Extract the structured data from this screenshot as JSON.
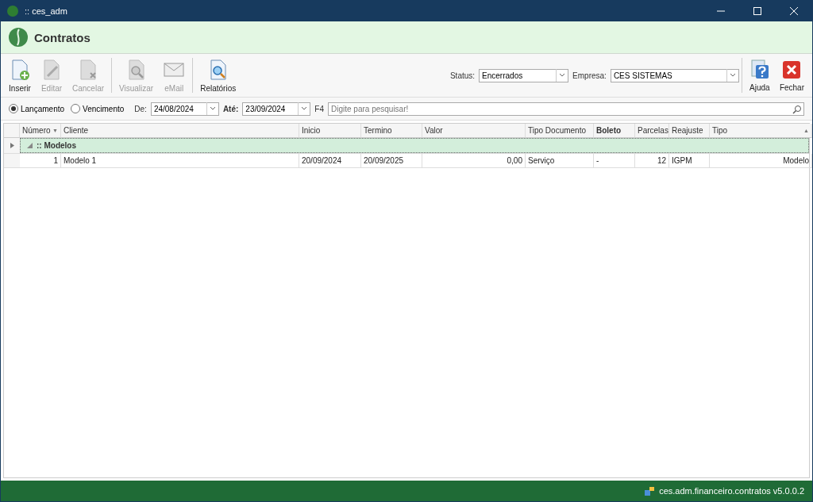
{
  "window": {
    "title": ":: ces_adm"
  },
  "header": {
    "title": "Contratos"
  },
  "toolbar": {
    "buttons": [
      {
        "label": "Inserir",
        "disabled": false
      },
      {
        "label": "Editar",
        "disabled": true
      },
      {
        "label": "Cancelar",
        "disabled": true
      },
      {
        "label": "Visualizar",
        "disabled": true
      },
      {
        "label": "eMail",
        "disabled": true
      },
      {
        "label": "Relatórios",
        "disabled": false
      }
    ],
    "status": {
      "label": "Status:",
      "value": "Encerrados"
    },
    "empresa": {
      "label": "Empresa:",
      "value": "CES SISTEMAS"
    },
    "right_buttons": [
      {
        "label": "Ajuda"
      },
      {
        "label": "Fechar"
      }
    ]
  },
  "filters": {
    "radios": [
      {
        "label": "Lançamento",
        "selected": true
      },
      {
        "label": "Vencimento",
        "selected": false
      }
    ],
    "from": {
      "label": "De:",
      "value": "24/08/2024"
    },
    "to": {
      "label": "Até:",
      "value": "23/09/2024"
    },
    "search": {
      "label": "F4",
      "placeholder": "Digite para pesquisar!"
    }
  },
  "table": {
    "columns": [
      {
        "label": "Número",
        "bold": false,
        "sort_mark": "▼"
      },
      {
        "label": "Cliente",
        "bold": false
      },
      {
        "label": "Inicio",
        "bold": false
      },
      {
        "label": "Termino",
        "bold": false
      },
      {
        "label": "Valor",
        "bold": false
      },
      {
        "label": "Tipo Documento",
        "bold": false
      },
      {
        "label": "Boleto",
        "bold": true
      },
      {
        "label": "Parcelas",
        "bold": false
      },
      {
        "label": "Reajuste",
        "bold": false
      },
      {
        "label": "Tipo",
        "bold": false,
        "sort_mark": "▲"
      }
    ],
    "group": {
      "label": ":: Modelos",
      "expanded": true
    },
    "rows": [
      [
        "1",
        "Modelo 1",
        "20/09/2024",
        "20/09/2025",
        "0,00",
        "Serviço",
        "-",
        "12",
        "IGPM",
        "Modelo"
      ]
    ]
  },
  "status_bar": {
    "text": "ces.adm.financeiro.contratos v5.0.0.2"
  }
}
